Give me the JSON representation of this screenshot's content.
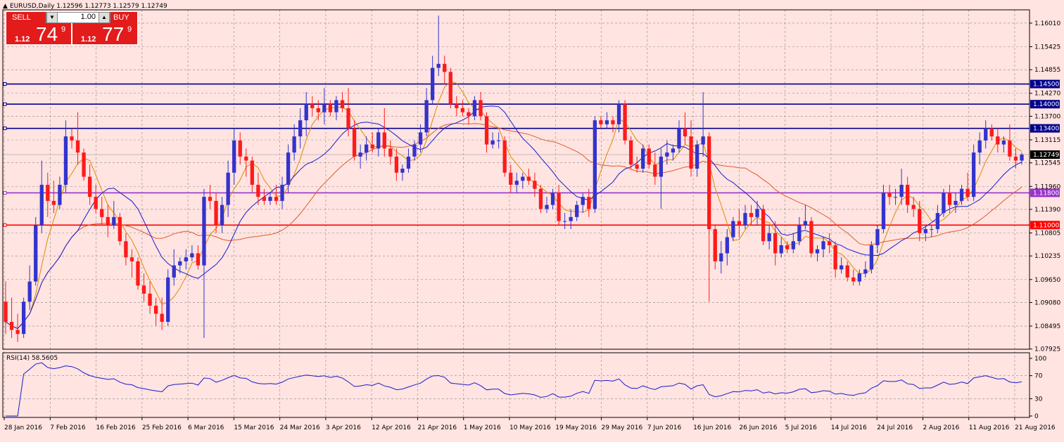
{
  "window": {
    "title": "EURUSD,Daily  1.12596 1.12773 1.12579 1.12749"
  },
  "trade_panel": {
    "sell_label": "SELL",
    "buy_label": "BUY",
    "lots": "1.00",
    "sell_prefix": "1.12",
    "sell_big": "74",
    "sell_sup": "9",
    "buy_prefix": "1.12",
    "buy_big": "77",
    "buy_sup": "9"
  },
  "colors": {
    "background": "#ffe4e1",
    "bull": "#3333cc",
    "bear": "#ff1a1a",
    "sma_fast": "#e08a00",
    "sma_mid": "#1a1acc",
    "sma_slow": "#e05a2a",
    "rsi_line": "#1a1acc"
  },
  "chart_data": [
    {
      "type": "candlestick",
      "symbol": "EURUSD",
      "timeframe": "Daily",
      "ylim": [
        1.0792,
        1.1634
      ],
      "y_ticks": [
        "1.16010",
        "1.15425",
        "1.14855",
        "1.14270",
        "1.13700",
        "1.13115",
        "1.12545",
        "1.11960",
        "1.11390",
        "1.10805",
        "1.10235",
        "1.09650",
        "1.09080",
        "1.08495",
        "1.07925"
      ],
      "x_ticks": [
        "28 Jan 2016",
        "7 Feb 2016",
        "16 Feb 2016",
        "25 Feb 2016",
        "6 Mar 2016",
        "15 Mar 2016",
        "24 Mar 2016",
        "3 Apr 2016",
        "12 Apr 2016",
        "21 Apr 2016",
        "1 May 2016",
        "10 May 2016",
        "19 May 2016",
        "29 May 2016",
        "7 Jun 2016",
        "16 Jun 2016",
        "26 Jun 2016",
        "5 Jul 2016",
        "14 Jul 2016",
        "24 Jul 2016",
        "2 Aug 2016",
        "11 Aug 2016",
        "21 Aug 2016"
      ],
      "levels": [
        {
          "label": "1.14500",
          "value": 1.145,
          "color": "#00008b"
        },
        {
          "label": "1.14000",
          "value": 1.14,
          "color": "#00008b"
        },
        {
          "label": "1.13400",
          "value": 1.134,
          "color": "#00008b"
        },
        {
          "label": "1.11800",
          "value": 1.118,
          "color": "#9932cc"
        },
        {
          "label": "1.11000",
          "value": 1.11,
          "color": "#ff0000"
        }
      ],
      "current_price": {
        "label": "1.12749",
        "value": 1.12749
      },
      "candles": [
        [
          1.091,
          1.096,
          1.083,
          1.086
        ],
        [
          1.086,
          1.092,
          1.082,
          1.084
        ],
        [
          1.084,
          1.088,
          1.081,
          1.083
        ],
        [
          1.083,
          1.092,
          1.082,
          1.091
        ],
        [
          1.091,
          1.1,
          1.089,
          1.096
        ],
        [
          1.096,
          1.112,
          1.095,
          1.11
        ],
        [
          1.11,
          1.126,
          1.108,
          1.12
        ],
        [
          1.12,
          1.123,
          1.112,
          1.116
        ],
        [
          1.116,
          1.121,
          1.113,
          1.115
        ],
        [
          1.115,
          1.122,
          1.114,
          1.12
        ],
        [
          1.12,
          1.136,
          1.118,
          1.132
        ],
        [
          1.132,
          1.134,
          1.129,
          1.131
        ],
        [
          1.131,
          1.138,
          1.125,
          1.128
        ],
        [
          1.128,
          1.129,
          1.121,
          1.122
        ],
        [
          1.122,
          1.125,
          1.115,
          1.117
        ],
        [
          1.117,
          1.12,
          1.113,
          1.114
        ],
        [
          1.114,
          1.117,
          1.11,
          1.112
        ],
        [
          1.112,
          1.115,
          1.107,
          1.11
        ],
        [
          1.11,
          1.116,
          1.109,
          1.112
        ],
        [
          1.112,
          1.113,
          1.105,
          1.106
        ],
        [
          1.106,
          1.108,
          1.1,
          1.102
        ],
        [
          1.102,
          1.104,
          1.097,
          1.101
        ],
        [
          1.101,
          1.102,
          1.094,
          1.095
        ],
        [
          1.095,
          1.098,
          1.091,
          1.093
        ],
        [
          1.093,
          1.096,
          1.088,
          1.09
        ],
        [
          1.09,
          1.092,
          1.085,
          1.088
        ],
        [
          1.088,
          1.092,
          1.084,
          1.086
        ],
        [
          1.086,
          1.099,
          1.085,
          1.097
        ],
        [
          1.097,
          1.104,
          1.095,
          1.1
        ],
        [
          1.1,
          1.102,
          1.098,
          1.101
        ],
        [
          1.101,
          1.104,
          1.099,
          1.102
        ],
        [
          1.102,
          1.105,
          1.101,
          1.103
        ],
        [
          1.103,
          1.105,
          1.099,
          1.1
        ],
        [
          1.1,
          1.119,
          1.082,
          1.117
        ],
        [
          1.117,
          1.12,
          1.114,
          1.116
        ],
        [
          1.116,
          1.118,
          1.108,
          1.11
        ],
        [
          1.11,
          1.117,
          1.108,
          1.115
        ],
        [
          1.115,
          1.126,
          1.112,
          1.123
        ],
        [
          1.123,
          1.134,
          1.12,
          1.131
        ],
        [
          1.131,
          1.133,
          1.125,
          1.127
        ],
        [
          1.127,
          1.129,
          1.122,
          1.126
        ],
        [
          1.126,
          1.127,
          1.118,
          1.12
        ],
        [
          1.12,
          1.123,
          1.115,
          1.117
        ],
        [
          1.117,
          1.119,
          1.115,
          1.116
        ],
        [
          1.116,
          1.118,
          1.115,
          1.117
        ],
        [
          1.117,
          1.12,
          1.115,
          1.116
        ],
        [
          1.116,
          1.122,
          1.114,
          1.12
        ],
        [
          1.12,
          1.13,
          1.118,
          1.128
        ],
        [
          1.128,
          1.135,
          1.126,
          1.132
        ],
        [
          1.132,
          1.139,
          1.129,
          1.136
        ],
        [
          1.136,
          1.143,
          1.132,
          1.14
        ],
        [
          1.14,
          1.142,
          1.137,
          1.139
        ],
        [
          1.139,
          1.141,
          1.136,
          1.138
        ],
        [
          1.138,
          1.144,
          1.135,
          1.14
        ],
        [
          1.14,
          1.141,
          1.137,
          1.138
        ],
        [
          1.138,
          1.142,
          1.136,
          1.141
        ],
        [
          1.141,
          1.143,
          1.138,
          1.139
        ],
        [
          1.139,
          1.144,
          1.132,
          1.134
        ],
        [
          1.134,
          1.136,
          1.126,
          1.127
        ],
        [
          1.127,
          1.13,
          1.124,
          1.128
        ],
        [
          1.128,
          1.132,
          1.126,
          1.13
        ],
        [
          1.13,
          1.133,
          1.128,
          1.129
        ],
        [
          1.129,
          1.134,
          1.127,
          1.133
        ],
        [
          1.133,
          1.139,
          1.127,
          1.129
        ],
        [
          1.129,
          1.131,
          1.125,
          1.127
        ],
        [
          1.127,
          1.129,
          1.121,
          1.123
        ],
        [
          1.123,
          1.125,
          1.121,
          1.124
        ],
        [
          1.124,
          1.129,
          1.123,
          1.127
        ],
        [
          1.127,
          1.131,
          1.126,
          1.13
        ],
        [
          1.13,
          1.135,
          1.128,
          1.133
        ],
        [
          1.133,
          1.144,
          1.132,
          1.141
        ],
        [
          1.141,
          1.152,
          1.14,
          1.149
        ],
        [
          1.149,
          1.162,
          1.147,
          1.15
        ],
        [
          1.15,
          1.152,
          1.145,
          1.148
        ],
        [
          1.148,
          1.149,
          1.139,
          1.14
        ],
        [
          1.14,
          1.142,
          1.137,
          1.139
        ],
        [
          1.139,
          1.141,
          1.137,
          1.138
        ],
        [
          1.138,
          1.139,
          1.135,
          1.137
        ],
        [
          1.137,
          1.142,
          1.136,
          1.141
        ],
        [
          1.141,
          1.143,
          1.136,
          1.137
        ],
        [
          1.137,
          1.138,
          1.128,
          1.13
        ],
        [
          1.13,
          1.133,
          1.129,
          1.131
        ],
        [
          1.131,
          1.133,
          1.129,
          1.131
        ],
        [
          1.131,
          1.132,
          1.122,
          1.123
        ],
        [
          1.123,
          1.125,
          1.118,
          1.12
        ],
        [
          1.12,
          1.123,
          1.118,
          1.121
        ],
        [
          1.121,
          1.123,
          1.119,
          1.122
        ],
        [
          1.122,
          1.124,
          1.12,
          1.121
        ],
        [
          1.121,
          1.123,
          1.117,
          1.119
        ],
        [
          1.119,
          1.12,
          1.113,
          1.114
        ],
        [
          1.114,
          1.117,
          1.113,
          1.115
        ],
        [
          1.115,
          1.119,
          1.114,
          1.118
        ],
        [
          1.118,
          1.12,
          1.11,
          1.111
        ],
        [
          1.111,
          1.113,
          1.109,
          1.111
        ],
        [
          1.111,
          1.114,
          1.109,
          1.112
        ],
        [
          1.112,
          1.116,
          1.111,
          1.115
        ],
        [
          1.115,
          1.118,
          1.113,
          1.117
        ],
        [
          1.117,
          1.119,
          1.112,
          1.114
        ],
        [
          1.114,
          1.137,
          1.113,
          1.136
        ],
        [
          1.136,
          1.137,
          1.134,
          1.135
        ],
        [
          1.135,
          1.138,
          1.134,
          1.136
        ],
        [
          1.136,
          1.137,
          1.133,
          1.135
        ],
        [
          1.135,
          1.141,
          1.133,
          1.14
        ],
        [
          1.14,
          1.141,
          1.13,
          1.131
        ],
        [
          1.131,
          1.132,
          1.124,
          1.125
        ],
        [
          1.125,
          1.127,
          1.123,
          1.124
        ],
        [
          1.124,
          1.13,
          1.123,
          1.129
        ],
        [
          1.129,
          1.13,
          1.124,
          1.125
        ],
        [
          1.125,
          1.128,
          1.12,
          1.122
        ],
        [
          1.122,
          1.129,
          1.114,
          1.127
        ],
        [
          1.127,
          1.131,
          1.125,
          1.128
        ],
        [
          1.128,
          1.13,
          1.126,
          1.129
        ],
        [
          1.129,
          1.136,
          1.128,
          1.134
        ],
        [
          1.134,
          1.138,
          1.13,
          1.132
        ],
        [
          1.132,
          1.136,
          1.122,
          1.124
        ],
        [
          1.124,
          1.131,
          1.122,
          1.13
        ],
        [
          1.13,
          1.143,
          1.127,
          1.132
        ],
        [
          1.132,
          1.133,
          1.091,
          1.109
        ],
        [
          1.109,
          1.11,
          1.099,
          1.101
        ],
        [
          1.101,
          1.106,
          1.098,
          1.103
        ],
        [
          1.103,
          1.109,
          1.1,
          1.107
        ],
        [
          1.107,
          1.112,
          1.106,
          1.111
        ],
        [
          1.111,
          1.114,
          1.107,
          1.11
        ],
        [
          1.11,
          1.115,
          1.109,
          1.113
        ],
        [
          1.113,
          1.115,
          1.11,
          1.112
        ],
        [
          1.112,
          1.116,
          1.11,
          1.114
        ],
        [
          1.114,
          1.115,
          1.105,
          1.106
        ],
        [
          1.106,
          1.11,
          1.104,
          1.108
        ],
        [
          1.108,
          1.111,
          1.1,
          1.103
        ],
        [
          1.103,
          1.107,
          1.102,
          1.105
        ],
        [
          1.105,
          1.106,
          1.103,
          1.104
        ],
        [
          1.104,
          1.108,
          1.103,
          1.106
        ],
        [
          1.106,
          1.112,
          1.105,
          1.11
        ],
        [
          1.11,
          1.115,
          1.109,
          1.111
        ],
        [
          1.111,
          1.112,
          1.102,
          1.103
        ],
        [
          1.103,
          1.105,
          1.101,
          1.104
        ],
        [
          1.104,
          1.107,
          1.102,
          1.106
        ],
        [
          1.106,
          1.108,
          1.103,
          1.105
        ],
        [
          1.105,
          1.106,
          1.097,
          1.099
        ],
        [
          1.099,
          1.102,
          1.098,
          1.1
        ],
        [
          1.1,
          1.101,
          1.096,
          1.097
        ],
        [
          1.097,
          1.099,
          1.095,
          1.096
        ],
        [
          1.096,
          1.099,
          1.095,
          1.098
        ],
        [
          1.098,
          1.101,
          1.097,
          1.099
        ],
        [
          1.099,
          1.106,
          1.098,
          1.105
        ],
        [
          1.105,
          1.11,
          1.103,
          1.109
        ],
        [
          1.109,
          1.12,
          1.108,
          1.118
        ],
        [
          1.118,
          1.12,
          1.115,
          1.117
        ],
        [
          1.117,
          1.119,
          1.115,
          1.117
        ],
        [
          1.117,
          1.124,
          1.115,
          1.12
        ],
        [
          1.12,
          1.122,
          1.113,
          1.115
        ],
        [
          1.115,
          1.117,
          1.112,
          1.114
        ],
        [
          1.114,
          1.116,
          1.106,
          1.108
        ],
        [
          1.108,
          1.11,
          1.106,
          1.109
        ],
        [
          1.109,
          1.11,
          1.107,
          1.109
        ],
        [
          1.109,
          1.115,
          1.108,
          1.113
        ],
        [
          1.113,
          1.119,
          1.112,
          1.118
        ],
        [
          1.118,
          1.12,
          1.113,
          1.115
        ],
        [
          1.115,
          1.118,
          1.113,
          1.116
        ],
        [
          1.116,
          1.12,
          1.115,
          1.119
        ],
        [
          1.119,
          1.123,
          1.116,
          1.117
        ],
        [
          1.117,
          1.13,
          1.116,
          1.128
        ],
        [
          1.128,
          1.133,
          1.125,
          1.131
        ],
        [
          1.131,
          1.136,
          1.129,
          1.134
        ],
        [
          1.134,
          1.135,
          1.131,
          1.132
        ],
        [
          1.132,
          1.134,
          1.128,
          1.13
        ],
        [
          1.13,
          1.132,
          1.128,
          1.131
        ],
        [
          1.131,
          1.135,
          1.126,
          1.127
        ],
        [
          1.127,
          1.129,
          1.124,
          1.126
        ],
        [
          1.126,
          1.128,
          1.125,
          1.1275
        ]
      ],
      "ma_periods": {
        "sma_fast": 5,
        "sma_mid": 13,
        "sma_slow": 26
      }
    },
    {
      "type": "line",
      "title": "RSI(14) 58.5605",
      "ylim": [
        0,
        100
      ],
      "y_ticks": [
        "100",
        "70",
        "30",
        "0"
      ],
      "levels": [
        70,
        30
      ],
      "period": 14
    }
  ]
}
